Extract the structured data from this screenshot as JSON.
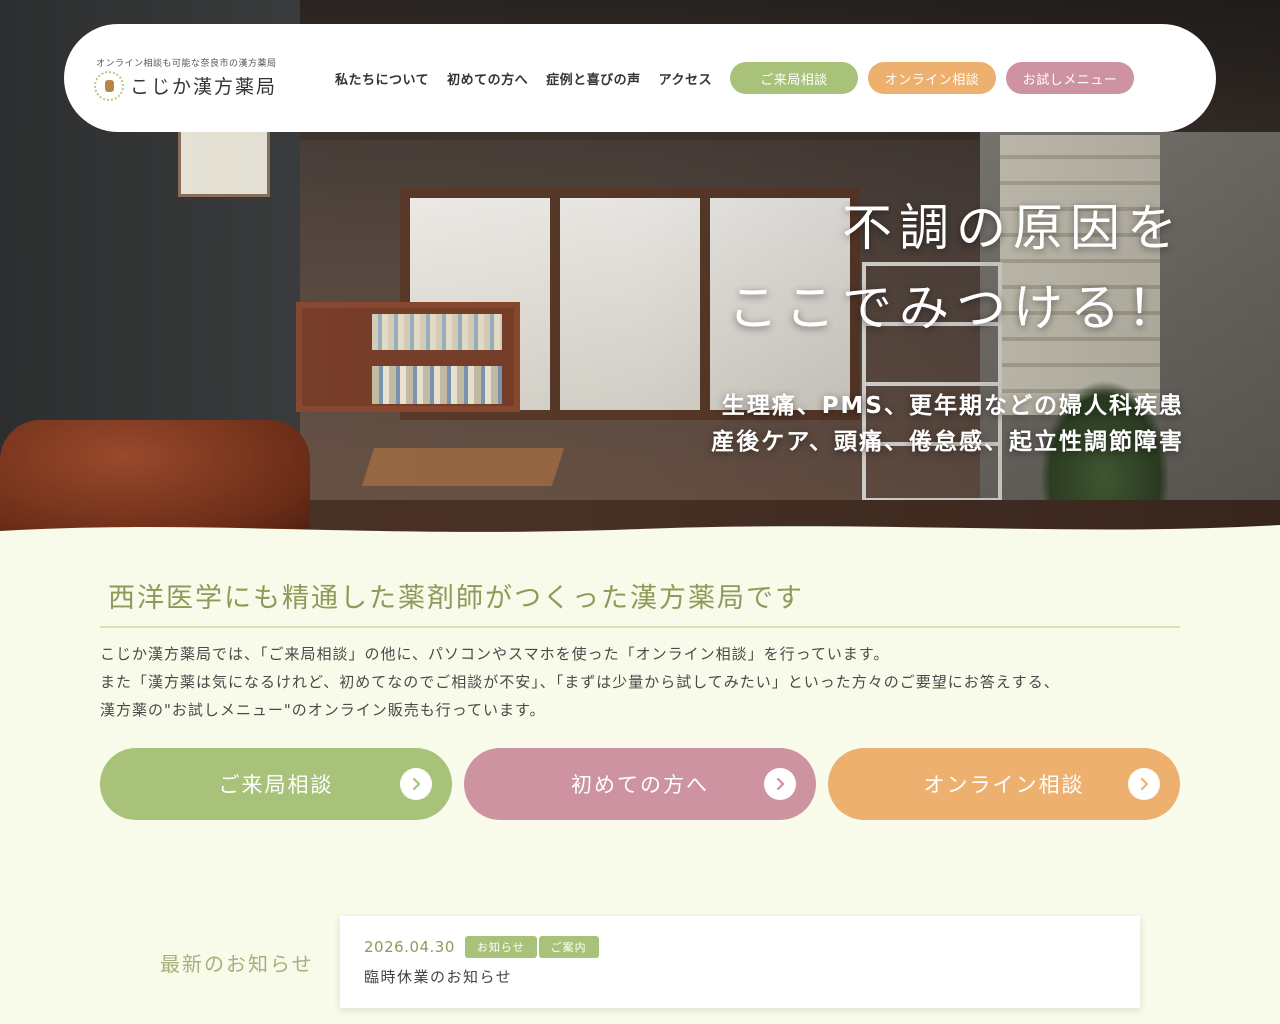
{
  "header": {
    "tagline": "オンライン相談も可能な奈良市の漢方薬局",
    "brand_name": "こじか漢方薬局",
    "nav": [
      {
        "label": "私たちについて"
      },
      {
        "label": "初めての方へ"
      },
      {
        "label": "症例と喜びの声"
      },
      {
        "label": "アクセス"
      }
    ],
    "pills": [
      {
        "label": "ご来局相談",
        "color": "#a9c27a"
      },
      {
        "label": "オンライン相談",
        "color": "#eeb06e"
      },
      {
        "label": "お試しメニュー",
        "color": "#cd93a1"
      }
    ]
  },
  "hero": {
    "headline_1": "不調の原因を",
    "headline_2": "ここでみつける！",
    "sub_1": "生理痛、PMS、更年期などの婦人科疾患",
    "sub_2": "産後ケア、頭痛、倦怠感、起立性調節障害"
  },
  "intro": {
    "title": "西洋医学にも精通した薬剤師がつくった漢方薬局です",
    "body_1": "こじか漢方薬局では、「ご来局相談」の他に、パソコンやスマホを使った「オンライン相談」を行っています。",
    "body_2": "また「漢方薬は気になるけれど、初めてなのでご相談が不安」、「まずは少量から試してみたい」といった方々のご要望にお答えする、",
    "body_3": "漢方薬の\"お試しメニュー\"のオンライン販売も行っています。"
  },
  "cta": [
    {
      "label": "ご来局相談",
      "color": "#a9c27a"
    },
    {
      "label": "初めての方へ",
      "color": "#cd93a1"
    },
    {
      "label": "オンライン相談",
      "color": "#eeb06e"
    }
  ],
  "news": {
    "section_label": "最新のお知らせ",
    "items": [
      {
        "date": "2026.04.30",
        "tags": [
          "お知らせ",
          "ご案内"
        ],
        "title": "臨時休業のお知らせ"
      }
    ]
  },
  "colors": {
    "background": "#f8fbea",
    "accent_green": "#a9c27a",
    "accent_pink": "#cd93a1",
    "accent_orange": "#eeb06e",
    "title_olive": "#8f9a5a"
  }
}
